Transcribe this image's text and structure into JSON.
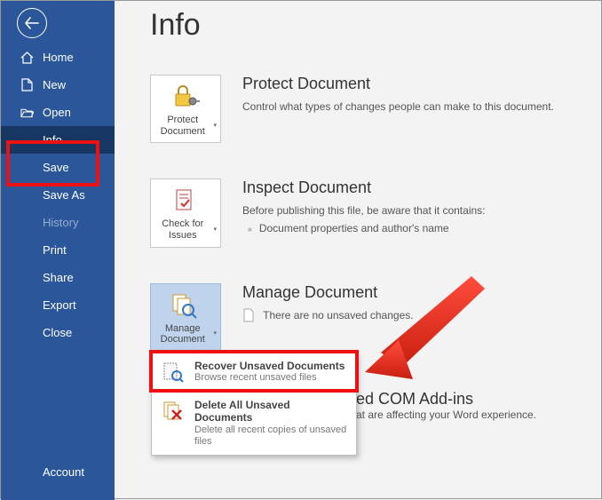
{
  "page": {
    "title": "Info"
  },
  "sidebar": {
    "items": [
      {
        "label": "Home"
      },
      {
        "label": "New"
      },
      {
        "label": "Open"
      },
      {
        "label": "Info"
      },
      {
        "label": "Save"
      },
      {
        "label": "Save As"
      },
      {
        "label": "History"
      },
      {
        "label": "Print"
      },
      {
        "label": "Share"
      },
      {
        "label": "Export"
      },
      {
        "label": "Close"
      }
    ],
    "account": "Account"
  },
  "sections": {
    "protect": {
      "tile": "Protect Document",
      "title": "Protect Document",
      "desc": "Control what types of changes people can make to this document."
    },
    "inspect": {
      "tile": "Check for Issues",
      "title": "Inspect Document",
      "desc": "Before publishing this file, be aware that it contains:",
      "bullet1": "Document properties and author's name"
    },
    "manage": {
      "tile": "Manage Document",
      "title": "Manage Document",
      "status": "There are no unsaved changes."
    },
    "addins": {
      "title_partial": "ed COM Add-ins",
      "desc_partial": "at are affecting your Word experience."
    }
  },
  "menu": {
    "recover": {
      "title": "Recover Unsaved Documents",
      "sub": "Browse recent unsaved files"
    },
    "delete": {
      "title": "Delete All Unsaved Documents",
      "sub": "Delete all recent copies of unsaved files"
    }
  }
}
